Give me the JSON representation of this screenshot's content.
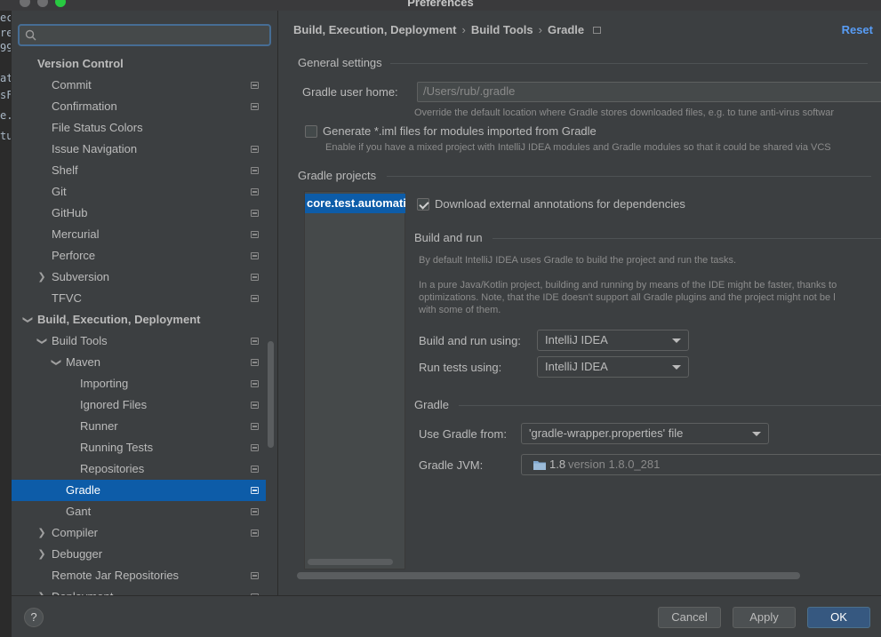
{
  "window": {
    "title": "Preferences"
  },
  "editor_snippet": [
    "ec",
    "re",
    "99",
    "at",
    "sF",
    "e.",
    "tu"
  ],
  "search": {
    "placeholder": ""
  },
  "sidebar": {
    "items": [
      {
        "label": "Version Control",
        "bold": true
      },
      {
        "label": "Commit"
      },
      {
        "label": "Confirmation"
      },
      {
        "label": "File Status Colors"
      },
      {
        "label": "Issue Navigation"
      },
      {
        "label": "Shelf"
      },
      {
        "label": "Git"
      },
      {
        "label": "GitHub"
      },
      {
        "label": "Mercurial"
      },
      {
        "label": "Perforce"
      },
      {
        "label": "Subversion"
      },
      {
        "label": "TFVC"
      },
      {
        "label": "Build, Execution, Deployment",
        "bold": true
      },
      {
        "label": "Build Tools"
      },
      {
        "label": "Maven"
      },
      {
        "label": "Importing"
      },
      {
        "label": "Ignored Files"
      },
      {
        "label": "Runner"
      },
      {
        "label": "Running Tests"
      },
      {
        "label": "Repositories"
      },
      {
        "label": "Gradle",
        "selected": true
      },
      {
        "label": "Gant"
      },
      {
        "label": "Compiler"
      },
      {
        "label": "Debugger"
      },
      {
        "label": "Remote Jar Repositories"
      },
      {
        "label": "Deployment"
      }
    ]
  },
  "breadcrumb": {
    "part1": "Build, Execution, Deployment",
    "part2": "Build Tools",
    "part3": "Gradle",
    "sep": "›"
  },
  "reset_label": "Reset",
  "general": {
    "title": "General settings",
    "home_label": "Gradle user home:",
    "home_placeholder": "/Users/rub/.gradle",
    "home_hint": "Override the default location where Gradle stores downloaded files, e.g. to tune anti-virus softwar",
    "iml_label": "Generate *.iml files for modules imported from Gradle",
    "iml_hint": "Enable if you have a mixed project with IntelliJ IDEA modules and Gradle modules so that it could be shared via VCS"
  },
  "projects": {
    "title": "Gradle projects",
    "item": "core.test.automatio",
    "download_label": "Download external annotations for dependencies"
  },
  "build_run": {
    "title": "Build and run",
    "hint1": "By default IntelliJ IDEA uses Gradle to build the project and run the tasks.",
    "hint2": "In a pure Java/Kotlin project, building and running by means of the IDE might be faster, thanks to",
    "hint3": "optimizations. Note, that the IDE doesn't support all Gradle plugins and the project might not be l",
    "hint4": "with some of them.",
    "build_label": "Build and run using:",
    "build_value": "IntelliJ IDEA",
    "tests_label": "Run tests using:",
    "tests_value": "IntelliJ IDEA"
  },
  "gradle": {
    "title": "Gradle",
    "use_label": "Use Gradle from:",
    "use_value": "'gradle-wrapper.properties' file",
    "jvm_label": "Gradle JVM:",
    "jvm_value": "1.8",
    "jvm_version": "version 1.8.0_281"
  },
  "buttons": {
    "help": "?",
    "cancel": "Cancel",
    "apply": "Apply",
    "ok": "OK"
  },
  "colors": {
    "selection": "#0d5ca8",
    "link": "#589df6",
    "background": "#3c3f41"
  }
}
